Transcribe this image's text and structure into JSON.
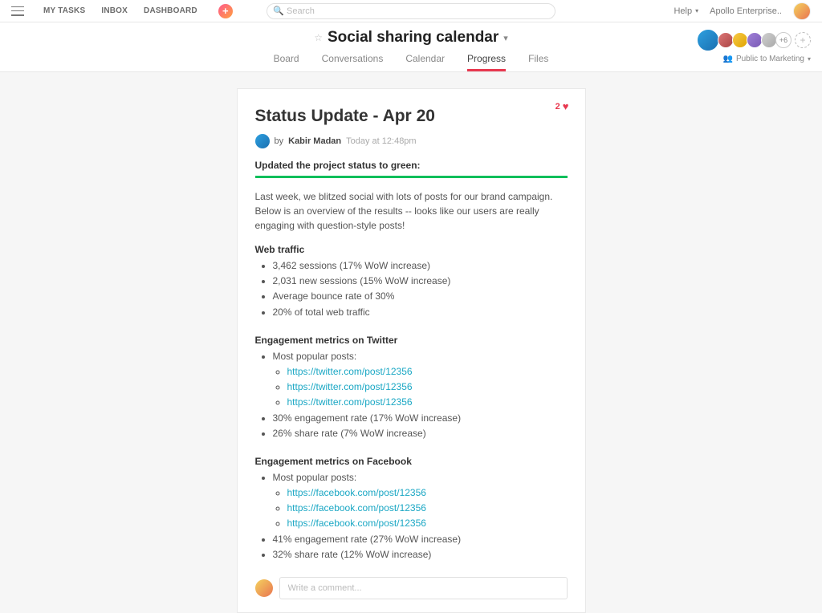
{
  "topnav": {
    "my_tasks": "MY TASKS",
    "inbox": "INBOX",
    "dashboard": "DASHBOARD"
  },
  "search": {
    "placeholder": "Search"
  },
  "help_label": "Help",
  "org_label": "Apollo Enterprise..",
  "project": {
    "title": "Social sharing calendar",
    "tabs": {
      "board": "Board",
      "conversations": "Conversations",
      "calendar": "Calendar",
      "progress": "Progress",
      "files": "Files"
    },
    "active_tab": "progress",
    "more_count": "+6",
    "visibility": "Public to Marketing"
  },
  "post": {
    "title": "Status Update - Apr 20",
    "like_count": "2",
    "by_prefix": "by",
    "author": "Kabir Madan",
    "timestamp": "Today at 12:48pm",
    "status_line": "Updated the project status to green:",
    "intro": "Last week, we blitzed social with lots of posts for our brand campaign. Below is an overview of the results -- looks like our users are really engaging with question-style posts!",
    "sections": {
      "web": {
        "heading": "Web traffic",
        "items": [
          "3,462 sessions (17% WoW increase)",
          "2,031 new sessions (15% WoW increase)",
          "Average bounce rate of 30%",
          "20% of total web traffic"
        ]
      },
      "twitter": {
        "heading": "Engagement metrics on Twitter",
        "lead": "Most popular posts:",
        "links": [
          "https://twitter.com/post/12356",
          "https://twitter.com/post/12356",
          "https://twitter.com/post/12356"
        ],
        "stats": [
          "30% engagement rate (17% WoW increase)",
          "26% share rate (7% WoW increase)"
        ]
      },
      "facebook": {
        "heading": "Engagement metrics on Facebook",
        "lead": "Most popular posts:",
        "links": [
          "https://facebook.com/post/12356",
          "https://facebook.com/post/12356",
          "https://facebook.com/post/12356"
        ],
        "stats": [
          "41% engagement rate (27% WoW increase)",
          "32% share rate (12% WoW increase)"
        ]
      }
    }
  },
  "comment": {
    "placeholder": "Write a comment..."
  }
}
